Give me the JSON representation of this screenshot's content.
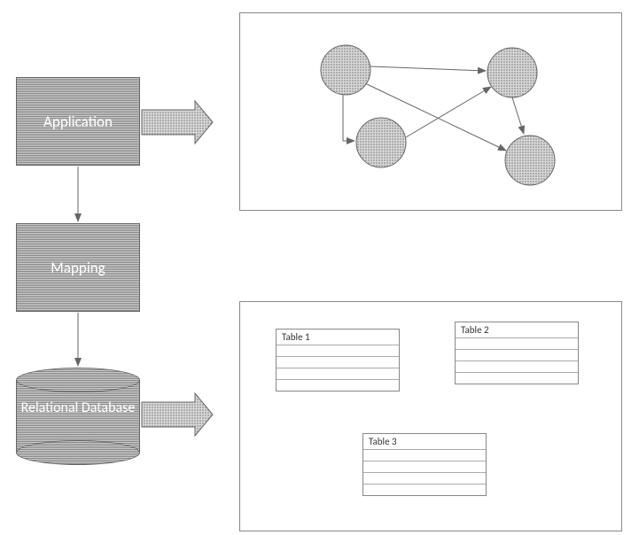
{
  "blocks": {
    "application": "Application",
    "mapping": "Mapping",
    "database": "Relational Database"
  },
  "tables": {
    "t1": "Table 1",
    "t2": "Table 2",
    "t3": "Table 3"
  },
  "colors": {
    "stroke": "#666",
    "fill": "#aaa"
  }
}
